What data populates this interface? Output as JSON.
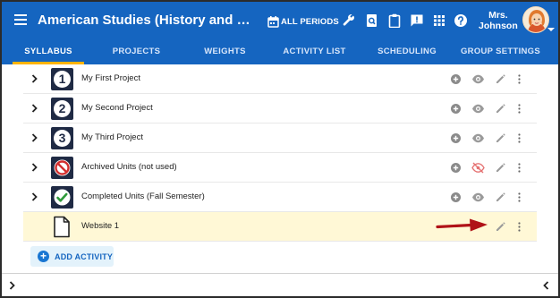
{
  "app": {
    "title": "American Studies (History and Language ...",
    "periods_label": "ALL PERIODS",
    "user": {
      "first": "Mrs.",
      "last": "Johnson"
    },
    "toolbar_icons": [
      "wrench-icon",
      "search-doc-icon",
      "clipboard-icon",
      "feedback-icon",
      "apps-grid-icon",
      "help-icon"
    ]
  },
  "tabs": [
    {
      "label": "SYLLABUS",
      "active": true
    },
    {
      "label": "PROJECTS",
      "active": false
    },
    {
      "label": "WEIGHTS",
      "active": false
    },
    {
      "label": "ACTIVITY LIST",
      "active": false
    },
    {
      "label": "SCHEDULING",
      "active": false
    },
    {
      "label": "GROUP SETTINGS",
      "active": false
    }
  ],
  "rows": [
    {
      "label": "My First Project",
      "icon": "number-1-icon",
      "glyph": "1",
      "hidden": false
    },
    {
      "label": "My Second Project",
      "icon": "number-2-icon",
      "glyph": "2",
      "hidden": false
    },
    {
      "label": "My Third Project",
      "icon": "number-3-icon",
      "glyph": "3",
      "hidden": false
    },
    {
      "label": "Archived Units (not used)",
      "icon": "prohibited-icon",
      "glyph": "",
      "hidden": true
    },
    {
      "label": "Completed Units (Fall Semester)",
      "icon": "checkmark-icon",
      "glyph": "",
      "hidden": false
    },
    {
      "label": "Website 1",
      "icon": "document-icon",
      "glyph": "",
      "highlighted": true
    }
  ],
  "add_activity": {
    "label": "ADD ACTIVITY"
  },
  "colors": {
    "brand": "#1565c0",
    "tab_indicator": "#ffb300",
    "highlight_row": "#fff8d6",
    "icon_tile": "#1f2a44",
    "annotation_arrow": "#b01218"
  }
}
